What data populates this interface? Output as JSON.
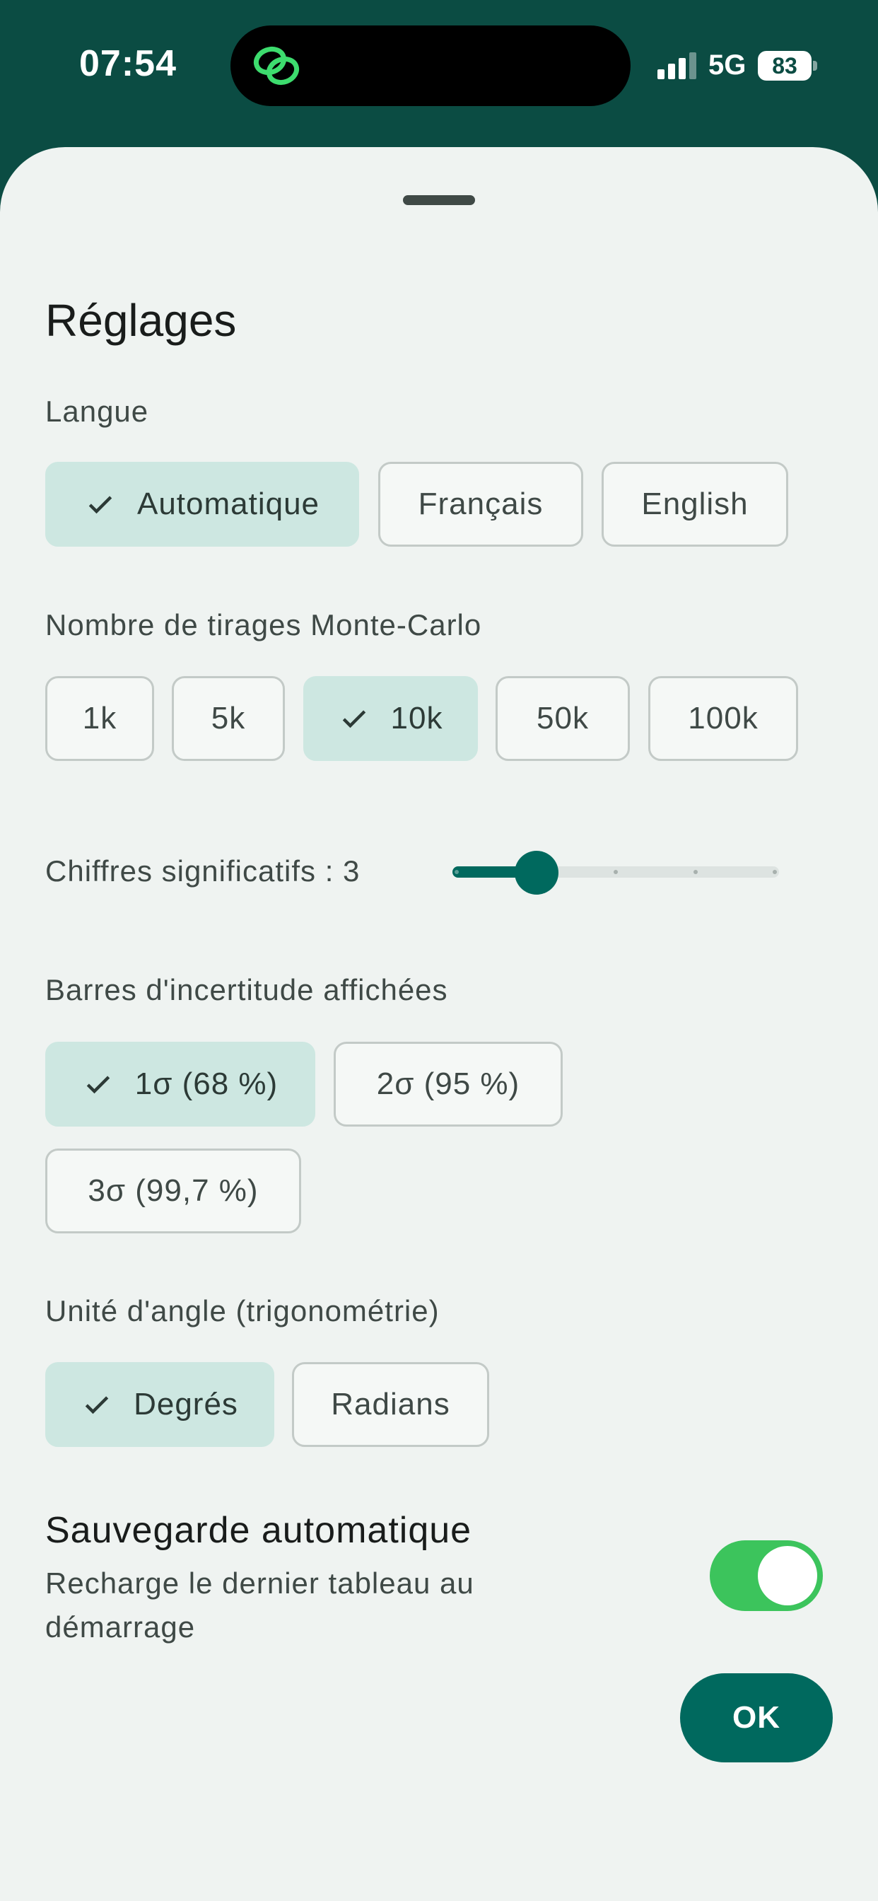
{
  "status_bar": {
    "time": "07:54",
    "network": "5G",
    "battery": "83",
    "island_icon": "chain-link-icon",
    "signal_icon": "signal-bars-icon"
  },
  "sheet": {
    "title": "Réglages",
    "language": {
      "label": "Langue",
      "options": [
        {
          "label": "Automatique",
          "selected": true
        },
        {
          "label": "Français",
          "selected": false
        },
        {
          "label": "English",
          "selected": false
        }
      ]
    },
    "monte_carlo": {
      "label": "Nombre de tirages Monte-Carlo",
      "options": [
        {
          "label": "1k",
          "selected": false
        },
        {
          "label": "5k",
          "selected": false
        },
        {
          "label": "10k",
          "selected": true
        },
        {
          "label": "50k",
          "selected": false
        },
        {
          "label": "100k",
          "selected": false
        }
      ]
    },
    "significant_digits": {
      "label": "Chiffres significatifs : 3",
      "value": 3,
      "min": 2,
      "max": 6
    },
    "error_bars": {
      "label": "Barres d'incertitude affichées",
      "options": [
        {
          "label": "1σ (68 %)",
          "selected": true
        },
        {
          "label": "2σ (95 %)",
          "selected": false
        },
        {
          "label": "3σ (99,7 %)",
          "selected": false
        }
      ]
    },
    "angle_unit": {
      "label": "Unité d'angle (trigonométrie)",
      "options": [
        {
          "label": "Degrés",
          "selected": true
        },
        {
          "label": "Radians",
          "selected": false
        }
      ]
    },
    "autosave": {
      "title": "Sauvegarde automatique",
      "subtitle": "Recharge le dernier tableau au démarrage",
      "enabled": true
    },
    "ok_label": "OK"
  },
  "colors": {
    "header_bg": "#0b4c43",
    "sheet_bg": "#eff3f1",
    "accent": "#00695e",
    "chip_selected": "#cde7e1",
    "toggle_on": "#3cc45c"
  }
}
